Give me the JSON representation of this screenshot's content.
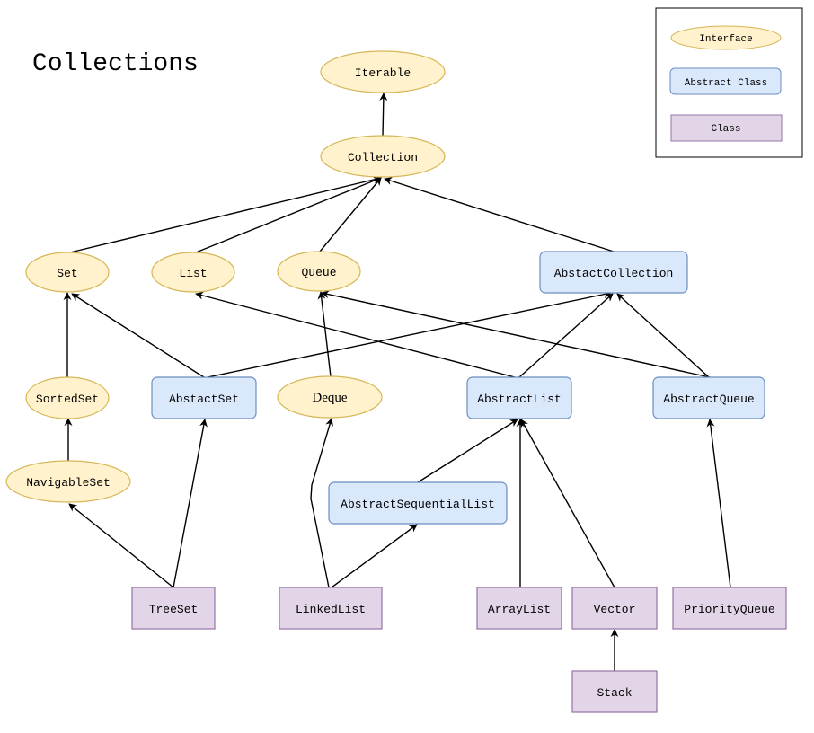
{
  "title": "Collections",
  "colors": {
    "interface_fill": "#fff2cc",
    "interface_stroke": "#d6b656",
    "abstract_fill": "#dae8fc",
    "abstract_stroke": "#6c8ebf",
    "class_fill": "#e1d5e7",
    "class_stroke": "#9673a6",
    "edge": "#000000"
  },
  "legend": {
    "interface": "Interface",
    "abstract_class": "Abstract Class",
    "class": "Class"
  },
  "nodes": [
    {
      "id": "iterable",
      "label": "Iterable",
      "kind": "interface"
    },
    {
      "id": "collection",
      "label": "Collection",
      "kind": "interface"
    },
    {
      "id": "set",
      "label": "Set",
      "kind": "interface"
    },
    {
      "id": "list",
      "label": "List",
      "kind": "interface"
    },
    {
      "id": "queue",
      "label": "Queue",
      "kind": "interface"
    },
    {
      "id": "abstact-collection",
      "label": "AbstactCollection",
      "kind": "abstract"
    },
    {
      "id": "sorted-set",
      "label": "SortedSet",
      "kind": "interface"
    },
    {
      "id": "abstact-set",
      "label": "AbstactSet",
      "kind": "abstract"
    },
    {
      "id": "deque",
      "label": "Deque",
      "kind": "interface"
    },
    {
      "id": "abstract-list",
      "label": "AbstractList",
      "kind": "abstract"
    },
    {
      "id": "abstract-queue",
      "label": "AbstractQueue",
      "kind": "abstract"
    },
    {
      "id": "navigable-set",
      "label": "NavigableSet",
      "kind": "interface"
    },
    {
      "id": "abstract-sequential-list",
      "label": "AbstractSequentialList",
      "kind": "abstract"
    },
    {
      "id": "tree-set",
      "label": "TreeSet",
      "kind": "class"
    },
    {
      "id": "linked-list",
      "label": "LinkedList",
      "kind": "class"
    },
    {
      "id": "array-list",
      "label": "ArrayList",
      "kind": "class"
    },
    {
      "id": "vector",
      "label": "Vector",
      "kind": "class"
    },
    {
      "id": "priority-queue",
      "label": "PriorityQueue",
      "kind": "class"
    },
    {
      "id": "stack",
      "label": "Stack",
      "kind": "class"
    }
  ],
  "edges": [
    {
      "from": "collection",
      "to": "iterable"
    },
    {
      "from": "set",
      "to": "collection"
    },
    {
      "from": "list",
      "to": "collection"
    },
    {
      "from": "queue",
      "to": "collection"
    },
    {
      "from": "abstact-collection",
      "to": "collection"
    },
    {
      "from": "sorted-set",
      "to": "set"
    },
    {
      "from": "abstact-set",
      "to": "set"
    },
    {
      "from": "abstact-set",
      "to": "abstact-collection"
    },
    {
      "from": "deque",
      "to": "queue"
    },
    {
      "from": "abstract-list",
      "to": "list"
    },
    {
      "from": "abstract-list",
      "to": "abstact-collection"
    },
    {
      "from": "abstract-queue",
      "to": "queue"
    },
    {
      "from": "abstract-queue",
      "to": "abstact-collection"
    },
    {
      "from": "navigable-set",
      "to": "sorted-set"
    },
    {
      "from": "tree-set",
      "to": "navigable-set"
    },
    {
      "from": "tree-set",
      "to": "abstact-set"
    },
    {
      "from": "linked-list",
      "to": "deque"
    },
    {
      "from": "linked-list",
      "to": "abstract-sequential-list"
    },
    {
      "from": "abstract-sequential-list",
      "to": "abstract-list"
    },
    {
      "from": "array-list",
      "to": "abstract-list"
    },
    {
      "from": "vector",
      "to": "abstract-list"
    },
    {
      "from": "priority-queue",
      "to": "abstract-queue"
    },
    {
      "from": "stack",
      "to": "vector"
    }
  ]
}
